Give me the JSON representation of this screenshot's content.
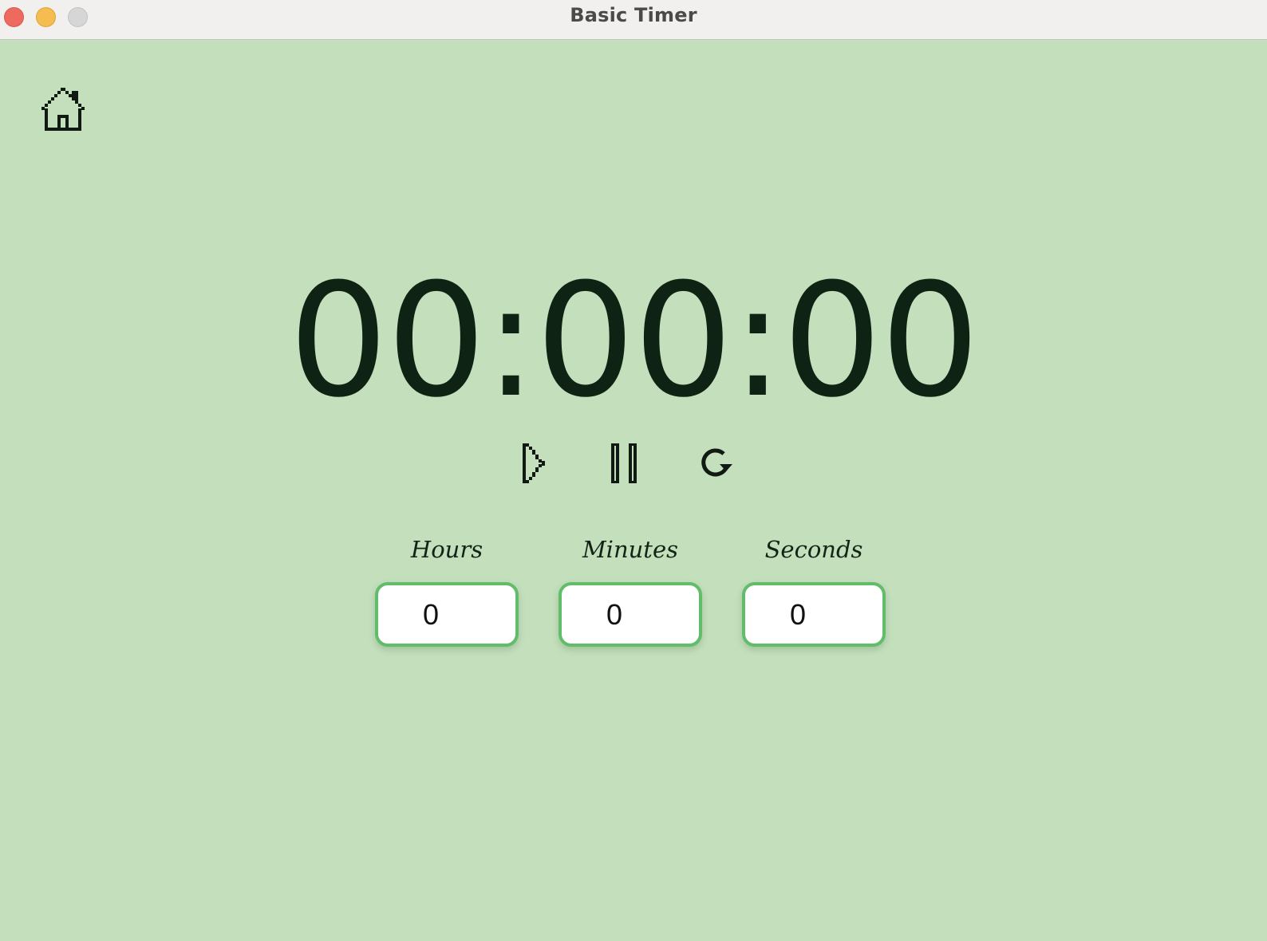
{
  "window": {
    "title": "Basic Timer"
  },
  "colors": {
    "background": "#c3dfbc",
    "titlebar": "#f1f0ef",
    "accent_border": "#62bd6a",
    "text_dark": "#0e2313"
  },
  "icons": {
    "home": "home-icon",
    "start": "play-icon",
    "pause": "pause-icon",
    "reset": "reset-icon"
  },
  "timer": {
    "display": "00:00:00"
  },
  "inputs": {
    "hours": {
      "label": "Hours",
      "value": "0"
    },
    "minutes": {
      "label": "Minutes",
      "value": "0"
    },
    "seconds": {
      "label": "Seconds",
      "value": "0"
    }
  }
}
